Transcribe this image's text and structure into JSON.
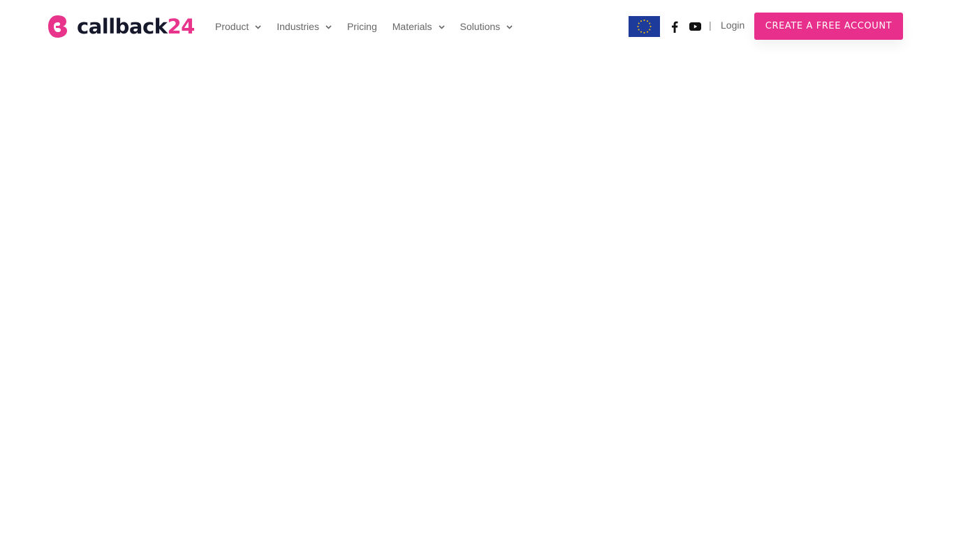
{
  "brand": {
    "name_dark": "callback",
    "name_accent": "24",
    "accent_color": "#e8348b",
    "dark_color": "#16182b"
  },
  "nav": {
    "items": [
      {
        "label": "Product",
        "has_dropdown": true
      },
      {
        "label": "Industries",
        "has_dropdown": true
      },
      {
        "label": "Pricing",
        "has_dropdown": false
      },
      {
        "label": "Materials",
        "has_dropdown": true
      },
      {
        "label": "Solutions",
        "has_dropdown": true
      }
    ]
  },
  "header_right": {
    "flag": "eu-flag-icon",
    "social": [
      "facebook-icon",
      "youtube-icon"
    ],
    "separator": "|",
    "login_label": "Login",
    "cta_label": "CREATE A FREE ACCOUNT",
    "cta_color": "#e82f8b"
  }
}
